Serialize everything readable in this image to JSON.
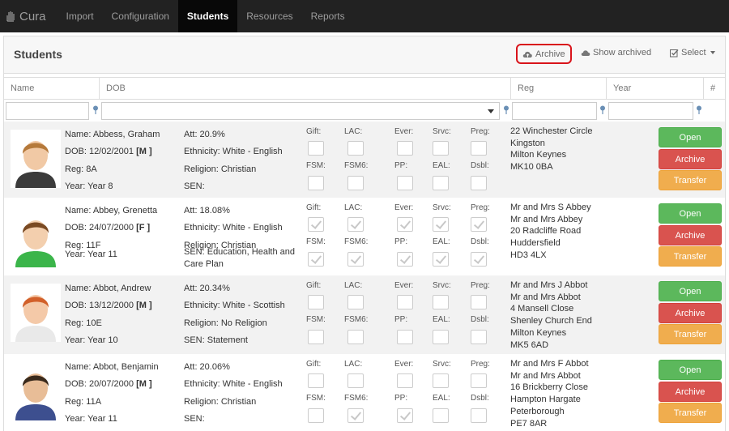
{
  "nav": {
    "brand": "Cura",
    "items": [
      "Import",
      "Configuration",
      "Students",
      "Resources",
      "Reports"
    ],
    "active": "Students"
  },
  "panel": {
    "title": "Students",
    "archive_label": "Archive",
    "show_archived_label": "Show archived",
    "select_label": "Select"
  },
  "columns": [
    "Name",
    "DOB",
    "Reg",
    "Year",
    "#"
  ],
  "flag_labels": [
    "Gift:",
    "LAC:",
    "Ever:",
    "Srvc:",
    "Preg:",
    "FSM:",
    "FSM6:",
    "PP:",
    "EAL:",
    "Dsbl:"
  ],
  "buttons": {
    "open": "Open",
    "archive": "Archive",
    "transfer": "Transfer"
  },
  "students": [
    {
      "name": "Name: Abbess, Graham",
      "dob": "DOB: 12/02/2001",
      "gender": "[M ]",
      "reg": "Reg: 8A",
      "year": "Year: Year 8",
      "att": "Att: 20.9%",
      "ethnicity": "Ethnicity: White - English",
      "religion": "Religion: Christian",
      "sen": "SEN:",
      "flags": [
        false,
        false,
        false,
        false,
        false,
        false,
        false,
        false,
        false,
        false
      ],
      "address": [
        "22 Winchester Circle",
        "Kingston",
        "Milton Keynes",
        "MK10 0BA"
      ]
    },
    {
      "name": "Name: Abbey, Grenetta",
      "dob": "DOB: 24/07/2000",
      "gender": "[F ]",
      "reg": "Reg: 11F",
      "year": "Year: Year 11",
      "att": "Att: 18.08%",
      "ethnicity": "Ethnicity: White - English",
      "religion": "Religion: Christian",
      "sen": "SEN: Education, Health and",
      "sen2": "Care Plan",
      "flags": [
        true,
        true,
        true,
        true,
        true,
        true,
        true,
        true,
        true,
        true
      ],
      "address": [
        "Mr and Mrs S Abbey",
        "Mr and Mrs Abbey",
        "20 Radcliffe Road",
        "Huddersfield",
        "HD3 4LX"
      ]
    },
    {
      "name": "Name: Abbot, Andrew",
      "dob": "DOB: 13/12/2000",
      "gender": "[M ]",
      "reg": "Reg: 10E",
      "year": "Year: Year 10",
      "att": "Att: 20.34%",
      "ethnicity": "Ethnicity: White - Scottish",
      "religion": "Religion: No Religion",
      "sen": "SEN: Statement",
      "flags": [
        false,
        false,
        false,
        false,
        false,
        false,
        false,
        false,
        false,
        false
      ],
      "address": [
        "Mr and Mrs J Abbot",
        "Mr and Mrs Abbot",
        "4 Mansell Close",
        "Shenley Church End",
        "Milton Keynes",
        "MK5 6AD"
      ]
    },
    {
      "name": "Name: Abbot, Benjamin",
      "dob": "DOB: 20/07/2000",
      "gender": "[M ]",
      "reg": "Reg: 11A",
      "year": "Year: Year 11",
      "att": "Att: 20.06%",
      "ethnicity": "Ethnicity: White - English",
      "religion": "Religion: Christian",
      "sen": "SEN:",
      "flags": [
        false,
        false,
        false,
        false,
        false,
        false,
        true,
        true,
        false,
        false
      ],
      "address": [
        "Mr and Mrs F Abbot",
        "Mr and Mrs Abbot",
        "16 Brickberry Close",
        "Hampton Hargate",
        "Peterborough",
        "PE7 8AR"
      ]
    }
  ]
}
